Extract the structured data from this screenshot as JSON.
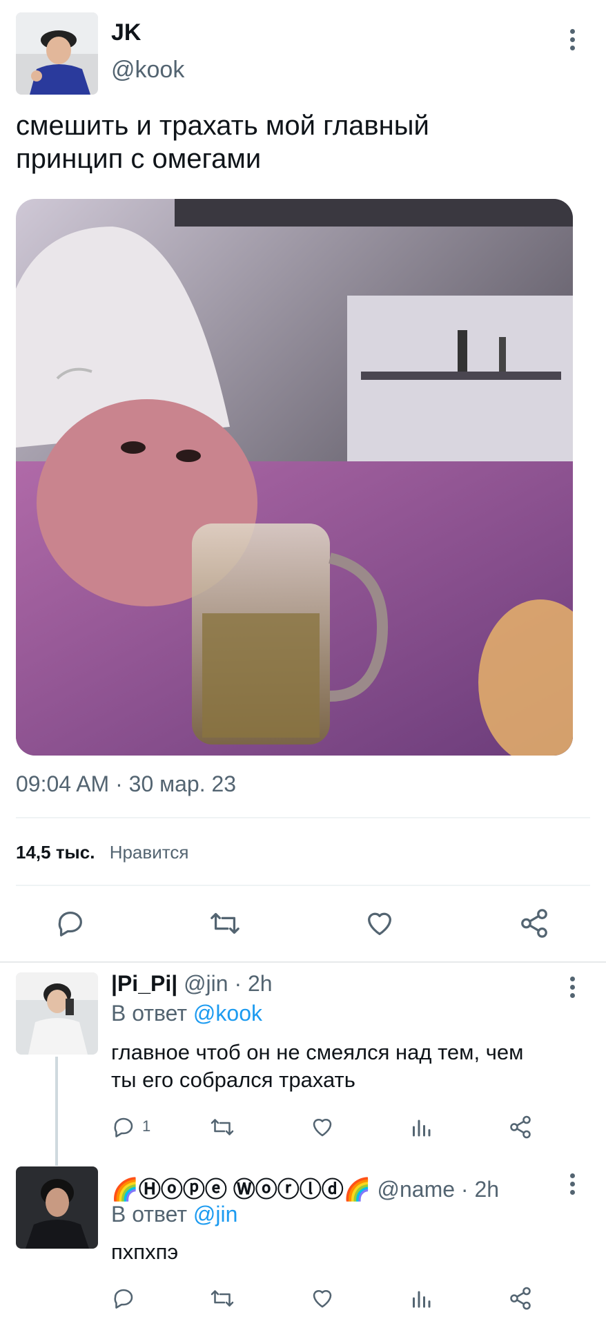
{
  "main_tweet": {
    "author_name": "JK",
    "author_handle": "@kook",
    "text_line1": "смешить и трахать  мой главный",
    "text_line2": "принцип с омегами",
    "timestamp": "09:04 AM · 30 мар. 23",
    "likes_count": "14,5 тыс.",
    "likes_label": "Нравится",
    "avatar_icon": "avatar-photo",
    "media_icon": "tweet-photo"
  },
  "replies": [
    {
      "author_name": "|Pi_Pi|",
      "author_handle": "@jin",
      "time": "· 2h",
      "reply_prefix": "В ответ",
      "reply_to": "@kook",
      "text_line1": "главное чтоб он не смеялся над тем,  чем",
      "text_line2": "ты его собрался трахать",
      "reply_count": "1"
    },
    {
      "author_name": "🌈Ⓗⓞⓟⓔ Ⓦⓞⓡⓛⓓ🌈",
      "author_handle": "@name",
      "time": "· 2h",
      "reply_prefix": "В ответ",
      "reply_to": "@jin",
      "text_line1": "пхпхпэ"
    }
  ],
  "colors": {
    "accent": "#1d9bf0",
    "secondary_text": "#536471",
    "primary_text": "#0f1419"
  }
}
